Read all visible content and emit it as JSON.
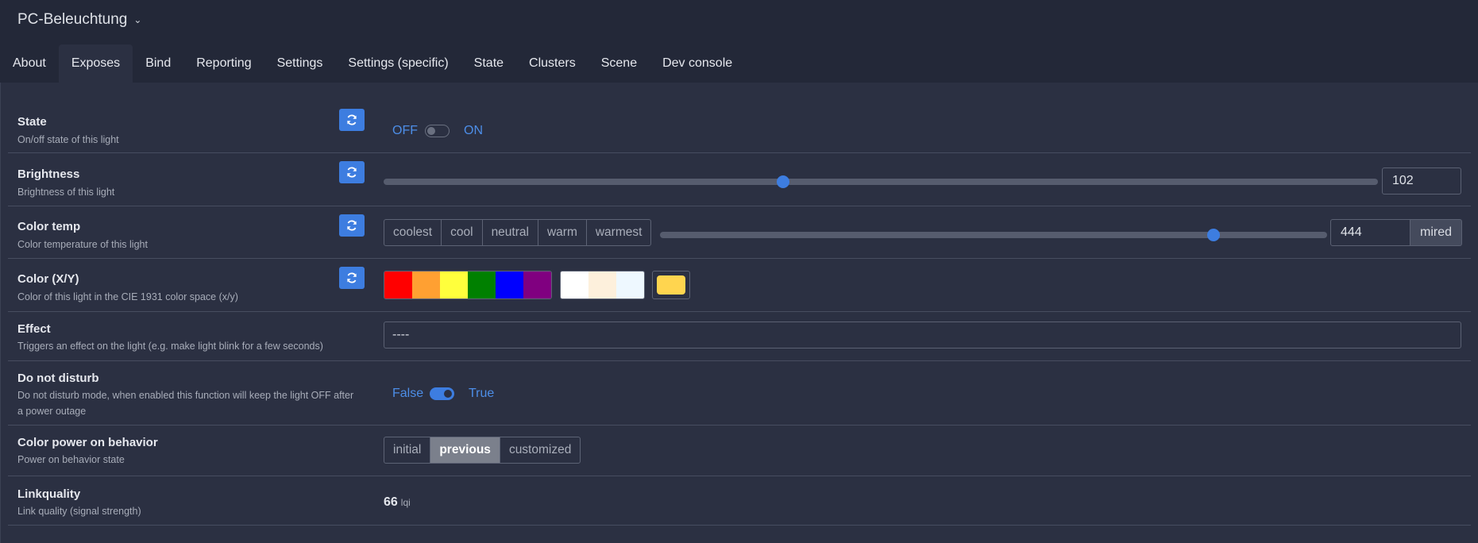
{
  "device": {
    "title": "PC-Beleuchtung"
  },
  "tabs": [
    {
      "label": "About"
    },
    {
      "label": "Exposes"
    },
    {
      "label": "Bind"
    },
    {
      "label": "Reporting"
    },
    {
      "label": "Settings"
    },
    {
      "label": "Settings (specific)"
    },
    {
      "label": "State"
    },
    {
      "label": "Clusters"
    },
    {
      "label": "Scene"
    },
    {
      "label": "Dev console"
    }
  ],
  "active_tab": "Exposes",
  "exposes": {
    "state": {
      "label": "State",
      "desc": "On/off state of this light",
      "off": "OFF",
      "on": "ON",
      "value": "OFF"
    },
    "brightness": {
      "label": "Brightness",
      "desc": "Brightness of this light",
      "value": "102",
      "max": 254
    },
    "color_temp": {
      "label": "Color temp",
      "desc": "Color temperature of this light",
      "presets": [
        "coolest",
        "cool",
        "neutral",
        "warm",
        "warmest"
      ],
      "value": "444",
      "unit": "mired",
      "slider_fraction": 0.83
    },
    "color_xy": {
      "label": "Color (X/Y)",
      "desc": "Color of this light in the CIE 1931 color space (x/y)",
      "palette": [
        "#ff0000",
        "#ffa032",
        "#ffff3c",
        "#008000",
        "#0000ff",
        "#800080"
      ],
      "whites": [
        "#ffffff",
        "#fdf0dc",
        "#eef8ff"
      ],
      "current": "#ffd54f"
    },
    "effect": {
      "label": "Effect",
      "desc": "Triggers an effect on the light (e.g. make light blink for a few seconds)",
      "value": "----"
    },
    "do_not_disturb": {
      "label": "Do not disturb",
      "desc1": "Do not disturb mode, when enabled this function will keep the light OFF after",
      "desc2": "a power outage",
      "false": "False",
      "true": "True",
      "value": "True"
    },
    "power_on": {
      "label": "Color power on behavior",
      "desc": "Power on behavior state",
      "options": [
        "initial",
        "previous",
        "customized"
      ],
      "selected": "previous"
    },
    "linkquality": {
      "label": "Linkquality",
      "desc": "Link quality (signal strength)",
      "value": "66",
      "unit": "lqi"
    }
  },
  "icons": {
    "refresh": "refresh-icon",
    "chevron": "chevron-down-icon"
  },
  "colors": {
    "accent": "#3d7de0",
    "background": "#2b3042"
  }
}
